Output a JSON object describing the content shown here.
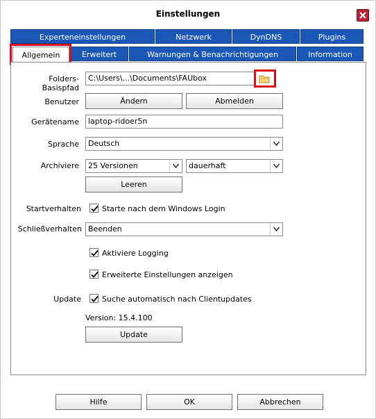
{
  "window": {
    "title": "Einstellungen"
  },
  "tabs_row1": [
    {
      "label": "Experteneinstellungen"
    },
    {
      "label": "Netzwerk"
    },
    {
      "label": "DynDNS"
    },
    {
      "label": "Plugins"
    }
  ],
  "tabs_row2": [
    {
      "label": "Allgemein"
    },
    {
      "label": "Erweitert"
    },
    {
      "label": "Warnungen & Benachrichtigungen"
    },
    {
      "label": "Information"
    }
  ],
  "form": {
    "folder_label": "Folders-Basispfad",
    "folder_value": "C:\\Users\\...\\Documents\\FAUbox",
    "user_label": "Benutzer",
    "change_btn": "Ändern",
    "logout_btn": "Abmelden",
    "device_label": "Gerätename",
    "device_value": "laptop-ridoer5n",
    "lang_label": "Sprache",
    "lang_value": "Deutsch",
    "archive_label": "Archiviere",
    "archive_versions": "25 Versionen",
    "archive_duration": "dauerhaft",
    "clear_btn": "Leeren",
    "startup_label": "Startverhalten",
    "startup_check": "Starte nach dem Windows Login",
    "close_label": "Schließverhalten",
    "close_value": "Beenden",
    "logging_check": "Aktiviere Logging",
    "advanced_check": "Erweiterte Einstellungen anzeigen",
    "update_label": "Update",
    "update_check": "Suche automatisch nach Clientupdates",
    "version_text": "Version: 15.4.100",
    "update_btn": "Update"
  },
  "footer": {
    "help": "Hilfe",
    "ok": "OK",
    "cancel": "Abbrechen"
  },
  "colors": {
    "tab_blue": "#1a57b6",
    "highlight_red": "#dd0d16",
    "close_red": "#b42435"
  }
}
